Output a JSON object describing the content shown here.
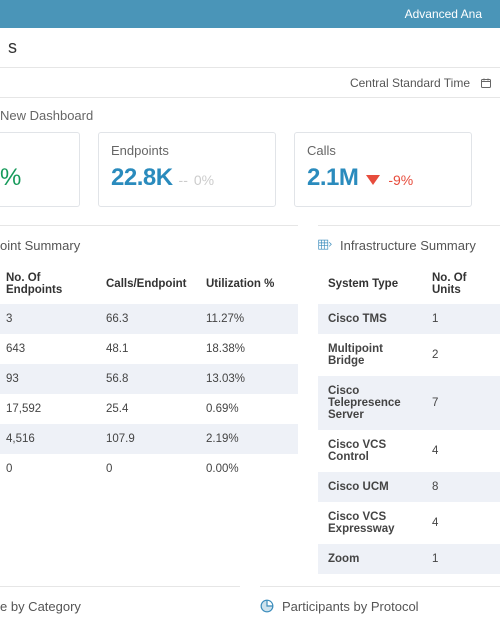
{
  "topbar": {
    "link": "Advanced Ana"
  },
  "header": {
    "title_partial": "s"
  },
  "subbar": {
    "tz": "Central Standard Time"
  },
  "dashboard_label": "New Dashboard",
  "cards": {
    "partial": {
      "percent": "%"
    },
    "endpoints": {
      "title": "Endpoints",
      "value": "22.8K",
      "dash": "--",
      "delta": "0%"
    },
    "calls": {
      "title": "Calls",
      "value": "2.1M",
      "delta": "-9%"
    }
  },
  "endpoint_summary": {
    "title": "oint Summary",
    "headers": [
      "No. Of Endpoints",
      "Calls/Endpoint",
      "Utilization %"
    ],
    "rows": [
      [
        "3",
        "66.3",
        "11.27%"
      ],
      [
        "643",
        "48.1",
        "18.38%"
      ],
      [
        "93",
        "56.8",
        "13.03%"
      ],
      [
        "17,592",
        "25.4",
        "0.69%"
      ],
      [
        "4,516",
        "107.9",
        "2.19%"
      ],
      [
        "0",
        "0",
        "0.00%"
      ]
    ]
  },
  "infra_summary": {
    "title": "Infrastructure Summary",
    "headers": [
      "System Type",
      "No. Of Units"
    ],
    "rows": [
      [
        "Cisco TMS",
        "1"
      ],
      [
        "Multipoint Bridge",
        "2"
      ],
      [
        "Cisco Telepresence Server",
        "7"
      ],
      [
        "Cisco VCS Control",
        "4"
      ],
      [
        "Cisco UCM",
        "8"
      ],
      [
        "Cisco VCS Expressway",
        "4"
      ],
      [
        "Zoom",
        "1"
      ]
    ]
  },
  "bottom": {
    "left": "e by Category",
    "right": "Participants by Protocol"
  }
}
